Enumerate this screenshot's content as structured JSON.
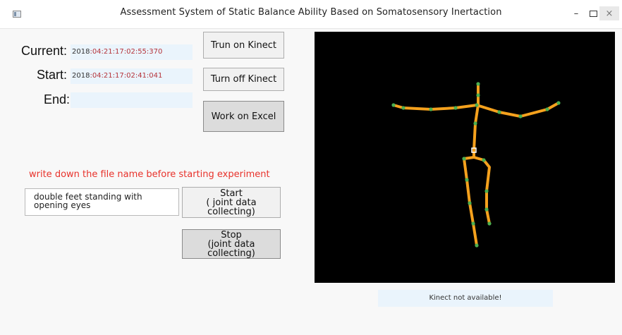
{
  "window": {
    "title": "Assessment System of Static Balance Ability Based on Somatosensory Inertaction",
    "minimize_glyph": "–",
    "close_glyph": "×",
    "icons": [
      "app-icon",
      "minimize-icon",
      "maximize-icon",
      "close-icon"
    ]
  },
  "times": {
    "current_label": "Current:",
    "current_prefix": "2018",
    "current_value": ":04:21:17:02:55:370",
    "start_label": "Start:",
    "start_prefix": "2018",
    "start_value": ":04:21:17:02:41:041",
    "end_label": "End:",
    "end_value": ""
  },
  "buttons": {
    "turn_on": "Trun on Kinect",
    "turn_off": "Turn off Kinect",
    "excel": "Work on Excel",
    "start_line1": "Start",
    "start_line2": "( joint data collecting)",
    "stop_line1": "Stop",
    "stop_line2": "(joint data collecting)"
  },
  "hint": "write down the file name before starting experiment",
  "filename": {
    "value": "double feet standing with opening eyes"
  },
  "skeleton": {
    "bone_color": "#f5a11d",
    "joint_color": "#4caf50",
    "head_color": "#ffffff"
  },
  "status": "Kinect not available!",
  "colors": {
    "hint": "#e8322b",
    "time_value": "#b5333a",
    "field_bg": "#eaf4fc",
    "canvas_bg": "#000000"
  }
}
